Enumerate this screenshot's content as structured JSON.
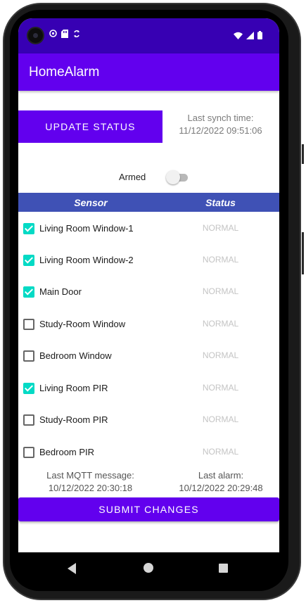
{
  "app": {
    "title": "HomeAlarm"
  },
  "status_bar": {
    "left_icons": [
      "notification-icon",
      "notification-icon",
      "sd-card-icon",
      "sync-icon"
    ],
    "right_icons": [
      "wifi-icon",
      "signal-icon",
      "battery-icon"
    ]
  },
  "controls": {
    "update_status_label": "UPDATE STATUS",
    "last_synch_label": "Last synch time:",
    "last_synch_value": "11/12/2022 09:51:06",
    "armed_label": "Armed",
    "armed_on": false
  },
  "table": {
    "headers": {
      "sensor": "Sensor",
      "status": "Status"
    },
    "rows": [
      {
        "name": "Living Room Window-1",
        "status": "NORMAL",
        "checked": true
      },
      {
        "name": "Living Room Window-2",
        "status": "NORMAL",
        "checked": true
      },
      {
        "name": "Main Door",
        "status": "NORMAL",
        "checked": true
      },
      {
        "name": "Study-Room Window",
        "status": "NORMAL",
        "checked": false
      },
      {
        "name": "Bedroom Window",
        "status": "NORMAL",
        "checked": false
      },
      {
        "name": "Living Room PIR",
        "status": "NORMAL",
        "checked": true
      },
      {
        "name": "Study-Room PIR",
        "status": "NORMAL",
        "checked": false
      },
      {
        "name": "Bedroom PIR",
        "status": "NORMAL",
        "checked": false
      }
    ]
  },
  "footer": {
    "last_mqtt_label": "Last MQTT message:",
    "last_mqtt_value": "10/12/2022 20:30:18",
    "last_alarm_label": "Last alarm:",
    "last_alarm_value": "10/12/2022 20:29:48",
    "submit_label": "SUBMIT CHANGES"
  },
  "colors": {
    "status_bar": "#3700b3",
    "primary": "#6200ee",
    "table_header": "#3f51b5",
    "checkbox_accent": "#03dac5"
  }
}
